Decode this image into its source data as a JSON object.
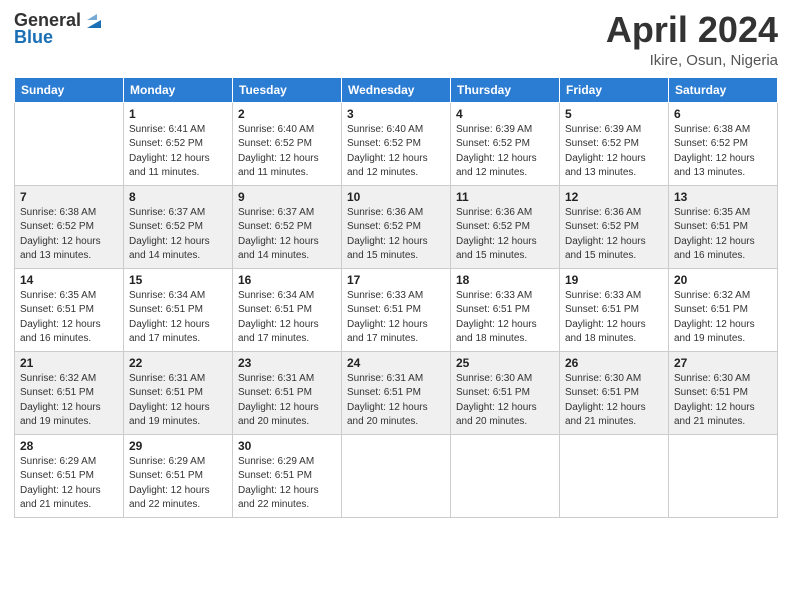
{
  "header": {
    "logo_general": "General",
    "logo_blue": "Blue",
    "title": "April 2024",
    "location": "Ikire, Osun, Nigeria"
  },
  "weekdays": [
    "Sunday",
    "Monday",
    "Tuesday",
    "Wednesday",
    "Thursday",
    "Friday",
    "Saturday"
  ],
  "rows": [
    [
      {
        "day": "",
        "sunrise": "",
        "sunset": "",
        "daylight": ""
      },
      {
        "day": "1",
        "sunrise": "Sunrise: 6:41 AM",
        "sunset": "Sunset: 6:52 PM",
        "daylight": "Daylight: 12 hours and 11 minutes."
      },
      {
        "day": "2",
        "sunrise": "Sunrise: 6:40 AM",
        "sunset": "Sunset: 6:52 PM",
        "daylight": "Daylight: 12 hours and 11 minutes."
      },
      {
        "day": "3",
        "sunrise": "Sunrise: 6:40 AM",
        "sunset": "Sunset: 6:52 PM",
        "daylight": "Daylight: 12 hours and 12 minutes."
      },
      {
        "day": "4",
        "sunrise": "Sunrise: 6:39 AM",
        "sunset": "Sunset: 6:52 PM",
        "daylight": "Daylight: 12 hours and 12 minutes."
      },
      {
        "day": "5",
        "sunrise": "Sunrise: 6:39 AM",
        "sunset": "Sunset: 6:52 PM",
        "daylight": "Daylight: 12 hours and 13 minutes."
      },
      {
        "day": "6",
        "sunrise": "Sunrise: 6:38 AM",
        "sunset": "Sunset: 6:52 PM",
        "daylight": "Daylight: 12 hours and 13 minutes."
      }
    ],
    [
      {
        "day": "7",
        "sunrise": "Sunrise: 6:38 AM",
        "sunset": "Sunset: 6:52 PM",
        "daylight": "Daylight: 12 hours and 13 minutes."
      },
      {
        "day": "8",
        "sunrise": "Sunrise: 6:37 AM",
        "sunset": "Sunset: 6:52 PM",
        "daylight": "Daylight: 12 hours and 14 minutes."
      },
      {
        "day": "9",
        "sunrise": "Sunrise: 6:37 AM",
        "sunset": "Sunset: 6:52 PM",
        "daylight": "Daylight: 12 hours and 14 minutes."
      },
      {
        "day": "10",
        "sunrise": "Sunrise: 6:36 AM",
        "sunset": "Sunset: 6:52 PM",
        "daylight": "Daylight: 12 hours and 15 minutes."
      },
      {
        "day": "11",
        "sunrise": "Sunrise: 6:36 AM",
        "sunset": "Sunset: 6:52 PM",
        "daylight": "Daylight: 12 hours and 15 minutes."
      },
      {
        "day": "12",
        "sunrise": "Sunrise: 6:36 AM",
        "sunset": "Sunset: 6:52 PM",
        "daylight": "Daylight: 12 hours and 15 minutes."
      },
      {
        "day": "13",
        "sunrise": "Sunrise: 6:35 AM",
        "sunset": "Sunset: 6:51 PM",
        "daylight": "Daylight: 12 hours and 16 minutes."
      }
    ],
    [
      {
        "day": "14",
        "sunrise": "Sunrise: 6:35 AM",
        "sunset": "Sunset: 6:51 PM",
        "daylight": "Daylight: 12 hours and 16 minutes."
      },
      {
        "day": "15",
        "sunrise": "Sunrise: 6:34 AM",
        "sunset": "Sunset: 6:51 PM",
        "daylight": "Daylight: 12 hours and 17 minutes."
      },
      {
        "day": "16",
        "sunrise": "Sunrise: 6:34 AM",
        "sunset": "Sunset: 6:51 PM",
        "daylight": "Daylight: 12 hours and 17 minutes."
      },
      {
        "day": "17",
        "sunrise": "Sunrise: 6:33 AM",
        "sunset": "Sunset: 6:51 PM",
        "daylight": "Daylight: 12 hours and 17 minutes."
      },
      {
        "day": "18",
        "sunrise": "Sunrise: 6:33 AM",
        "sunset": "Sunset: 6:51 PM",
        "daylight": "Daylight: 12 hours and 18 minutes."
      },
      {
        "day": "19",
        "sunrise": "Sunrise: 6:33 AM",
        "sunset": "Sunset: 6:51 PM",
        "daylight": "Daylight: 12 hours and 18 minutes."
      },
      {
        "day": "20",
        "sunrise": "Sunrise: 6:32 AM",
        "sunset": "Sunset: 6:51 PM",
        "daylight": "Daylight: 12 hours and 19 minutes."
      }
    ],
    [
      {
        "day": "21",
        "sunrise": "Sunrise: 6:32 AM",
        "sunset": "Sunset: 6:51 PM",
        "daylight": "Daylight: 12 hours and 19 minutes."
      },
      {
        "day": "22",
        "sunrise": "Sunrise: 6:31 AM",
        "sunset": "Sunset: 6:51 PM",
        "daylight": "Daylight: 12 hours and 19 minutes."
      },
      {
        "day": "23",
        "sunrise": "Sunrise: 6:31 AM",
        "sunset": "Sunset: 6:51 PM",
        "daylight": "Daylight: 12 hours and 20 minutes."
      },
      {
        "day": "24",
        "sunrise": "Sunrise: 6:31 AM",
        "sunset": "Sunset: 6:51 PM",
        "daylight": "Daylight: 12 hours and 20 minutes."
      },
      {
        "day": "25",
        "sunrise": "Sunrise: 6:30 AM",
        "sunset": "Sunset: 6:51 PM",
        "daylight": "Daylight: 12 hours and 20 minutes."
      },
      {
        "day": "26",
        "sunrise": "Sunrise: 6:30 AM",
        "sunset": "Sunset: 6:51 PM",
        "daylight": "Daylight: 12 hours and 21 minutes."
      },
      {
        "day": "27",
        "sunrise": "Sunrise: 6:30 AM",
        "sunset": "Sunset: 6:51 PM",
        "daylight": "Daylight: 12 hours and 21 minutes."
      }
    ],
    [
      {
        "day": "28",
        "sunrise": "Sunrise: 6:29 AM",
        "sunset": "Sunset: 6:51 PM",
        "daylight": "Daylight: 12 hours and 21 minutes."
      },
      {
        "day": "29",
        "sunrise": "Sunrise: 6:29 AM",
        "sunset": "Sunset: 6:51 PM",
        "daylight": "Daylight: 12 hours and 22 minutes."
      },
      {
        "day": "30",
        "sunrise": "Sunrise: 6:29 AM",
        "sunset": "Sunset: 6:51 PM",
        "daylight": "Daylight: 12 hours and 22 minutes."
      },
      {
        "day": "",
        "sunrise": "",
        "sunset": "",
        "daylight": ""
      },
      {
        "day": "",
        "sunrise": "",
        "sunset": "",
        "daylight": ""
      },
      {
        "day": "",
        "sunrise": "",
        "sunset": "",
        "daylight": ""
      },
      {
        "day": "",
        "sunrise": "",
        "sunset": "",
        "daylight": ""
      }
    ]
  ]
}
